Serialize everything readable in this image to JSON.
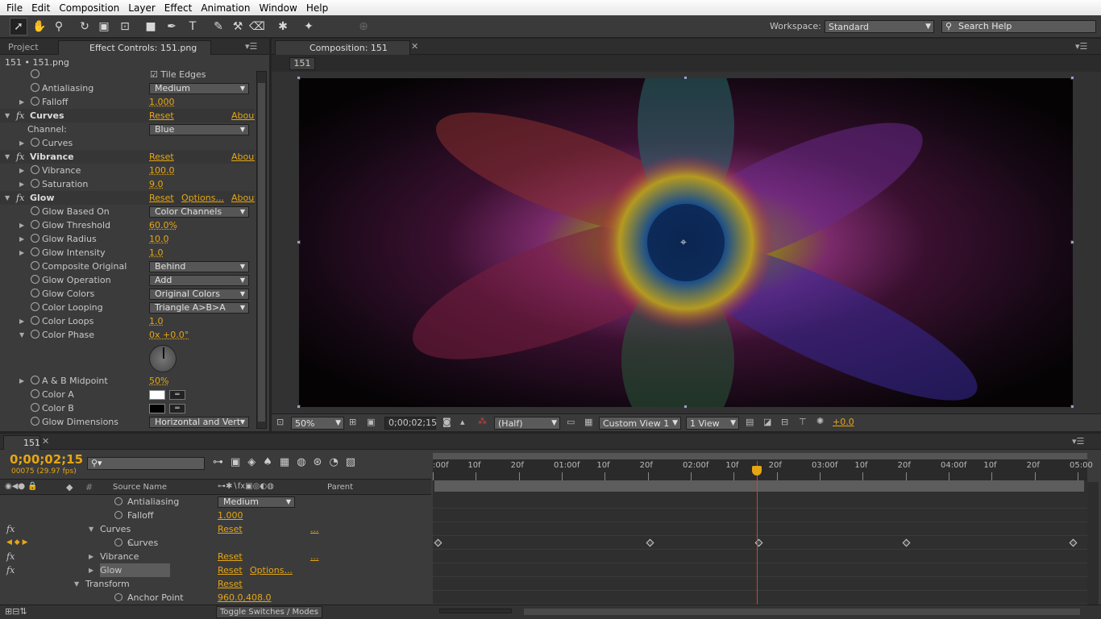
{
  "menu": [
    "File",
    "Edit",
    "Composition",
    "Layer",
    "Effect",
    "Animation",
    "Window",
    "Help"
  ],
  "toolbar": {
    "workspace_label": "Workspace:",
    "workspace_value": "Standard",
    "search_placeholder": "Search Help"
  },
  "left_tabs": {
    "project": "Project",
    "effect_controls": "Effect Controls: 151.png"
  },
  "layer_title": "151 • 151.png",
  "effect_rows": [
    {
      "name": "Tile Edges",
      "kind": "checkbox"
    },
    {
      "name": "Antialiasing",
      "kind": "dropdown",
      "value": "Medium"
    },
    {
      "name": "Falloff",
      "kind": "value",
      "value": "1.000"
    },
    {
      "name": "Curves",
      "kind": "fx",
      "reset": "Reset",
      "about": "About..."
    },
    {
      "name": "Channel:",
      "kind": "dropdown",
      "value": "Blue"
    },
    {
      "name": "Curves",
      "kind": "sub"
    },
    {
      "name": "Vibrance",
      "kind": "fx",
      "reset": "Reset",
      "about": "About..."
    },
    {
      "name": "Vibrance",
      "kind": "value",
      "value": "100.0"
    },
    {
      "name": "Saturation",
      "kind": "value",
      "value": "9.0"
    },
    {
      "name": "Glow",
      "kind": "fx",
      "reset": "Reset",
      "options": "Options...",
      "about": "About..."
    },
    {
      "name": "Glow Based On",
      "kind": "dropdown",
      "value": "Color Channels"
    },
    {
      "name": "Glow Threshold",
      "kind": "value",
      "value": "60.0%"
    },
    {
      "name": "Glow Radius",
      "kind": "value",
      "value": "10.0"
    },
    {
      "name": "Glow Intensity",
      "kind": "value",
      "value": "1.0"
    },
    {
      "name": "Composite Original",
      "kind": "dropdown",
      "value": "Behind"
    },
    {
      "name": "Glow Operation",
      "kind": "dropdown",
      "value": "Add"
    },
    {
      "name": "Glow Colors",
      "kind": "dropdown",
      "value": "Original Colors"
    },
    {
      "name": "Color Looping",
      "kind": "dropdown",
      "value": "Triangle A>B>A"
    },
    {
      "name": "Color Loops",
      "kind": "value",
      "value": "1.0"
    },
    {
      "name": "Color Phase",
      "kind": "value",
      "value": "0x +0.0°"
    },
    {
      "name": "A & B Midpoint",
      "kind": "value",
      "value": "50%"
    },
    {
      "name": "Color A",
      "kind": "color",
      "color": "#ffffff"
    },
    {
      "name": "Color B",
      "kind": "color",
      "color": "#000000"
    },
    {
      "name": "Glow Dimensions",
      "kind": "dropdown",
      "value": "Horizontal and Vert"
    }
  ],
  "comp": {
    "tab": "Composition: 151",
    "breadcrumb": "151",
    "zoom": "50%",
    "timecode": "0;00;02;15",
    "resolution": "(Half)",
    "view": "Custom View 1",
    "views": "1 View",
    "exposure": "+0.0"
  },
  "timeline": {
    "tab": "151",
    "timecode": "0;00;02;15",
    "frames": "00075 (29.97 fps)",
    "col_source": "Source Name",
    "col_parent": "Parent",
    "ruler": [
      ":00f",
      "10f",
      "20f",
      "01:00f",
      "10f",
      "20f",
      "02:00f",
      "10f",
      "20f",
      "03:00f",
      "10f",
      "20f",
      "04:00f",
      "10f",
      "20f",
      "05:00"
    ],
    "playhead_fraction": 0.5,
    "rows": [
      {
        "name": "Antialiasing",
        "value": "Medium",
        "indent": 2,
        "kind": "dropdown"
      },
      {
        "name": "Falloff",
        "value": "1.000",
        "indent": 2,
        "kind": "value"
      },
      {
        "name": "Curves",
        "value": "Reset",
        "extra": "...",
        "indent": 1,
        "kind": "fx"
      },
      {
        "name": "Curves",
        "indent": 2,
        "kind": "curves"
      },
      {
        "name": "Vibrance",
        "value": "Reset",
        "extra": "...",
        "indent": 1,
        "kind": "fx"
      },
      {
        "name": "Glow",
        "value": "Reset",
        "options": "Options...",
        "indent": 1,
        "kind": "fx"
      },
      {
        "name": "Transform",
        "value": "Reset",
        "indent": 0,
        "kind": "group"
      },
      {
        "name": "Anchor Point",
        "value": "960.0,408.0",
        "indent": 2,
        "kind": "value"
      }
    ],
    "toggle_label": "Toggle Switches / Modes"
  },
  "colors": {
    "accent": "#e6a614",
    "panel": "#3b3b3b",
    "dark": "#232323",
    "playhead": "#e33"
  }
}
